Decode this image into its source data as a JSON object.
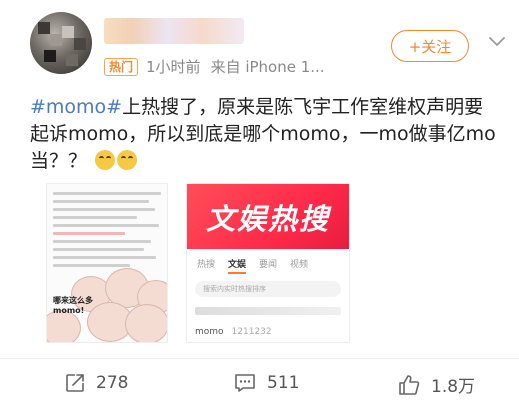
{
  "header": {
    "hot_tag": "热门",
    "time": "1小时前",
    "source": "来自 iPhone 1...",
    "follow_label": "+关注"
  },
  "post": {
    "topic": "#momo#",
    "text": "上热搜了，原来是陈飞宇工作室维权声明要起诉momo，所以到底是哪个momo，一mo做事亿mo当？？"
  },
  "images": {
    "left_caption": "哪来这么多momo!",
    "banner": "文娱热搜",
    "tabs": [
      "热搜",
      "文娱",
      "要闻",
      "视频"
    ],
    "active_tab": "文娱",
    "search_placeholder": "搜索内实时热搜排序",
    "momo_item": "momo",
    "momo_count": "1211232"
  },
  "actions": {
    "repost_count": "278",
    "comment_count": "511",
    "like_count": "1.8万"
  },
  "colors": {
    "accent": "#f08a2c",
    "topic": "#4b7bbd",
    "banner": "#ff2b4a"
  }
}
